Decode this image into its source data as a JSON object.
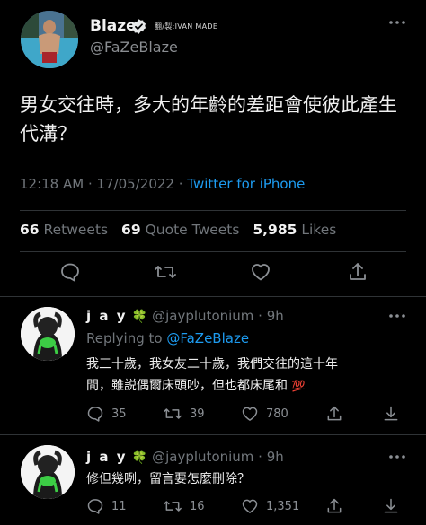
{
  "main_tweet": {
    "display_name": "Blaze",
    "credit_text": "翻/製:IVAN MADE",
    "handle": "@FaZeBlaze",
    "text": "男女交往時，多大的年齡的差距會使彼此產生代溝？",
    "timestamp": "12:18 AM · 17/05/2022 · ",
    "source": "Twitter for iPhone",
    "stats": {
      "retweets_count": "66",
      "retweets_label": "Retweets",
      "quotes_count": "69",
      "quotes_label": "Quote Tweets",
      "likes_count": "5,985",
      "likes_label": "Likes"
    }
  },
  "replies": [
    {
      "display_name": "j a y",
      "badge": "🍀",
      "handle_time": "@jayplutonium · 9h",
      "replying_prefix": "Replying to ",
      "replying_to": "@FaZeBlaze",
      "text_line1": "我三十歲，我女友二十歲，我們交往的這十年",
      "text_line2": "間，雖説偶爾床頭吵，但也都床尾和",
      "emoji": "💯",
      "reply_count": "35",
      "retweet_count": "39",
      "like_count": "780"
    },
    {
      "display_name": "j a y",
      "badge": "🍀",
      "handle_time": "@jayplutonium · 9h",
      "text_line1": "修但幾咧，留言要怎麼刪除？",
      "reply_count": "11",
      "retweet_count": "16",
      "like_count": "1,351"
    }
  ],
  "icons": [
    "verified-icon",
    "more-icon",
    "reply-icon",
    "retweet-icon",
    "like-icon",
    "share-icon",
    "download-icon",
    "clover-icon"
  ],
  "colors": {
    "background": "#000000",
    "link": "#1d9bf0",
    "verified": "#e7e9ea",
    "secondary": "#71767b"
  }
}
